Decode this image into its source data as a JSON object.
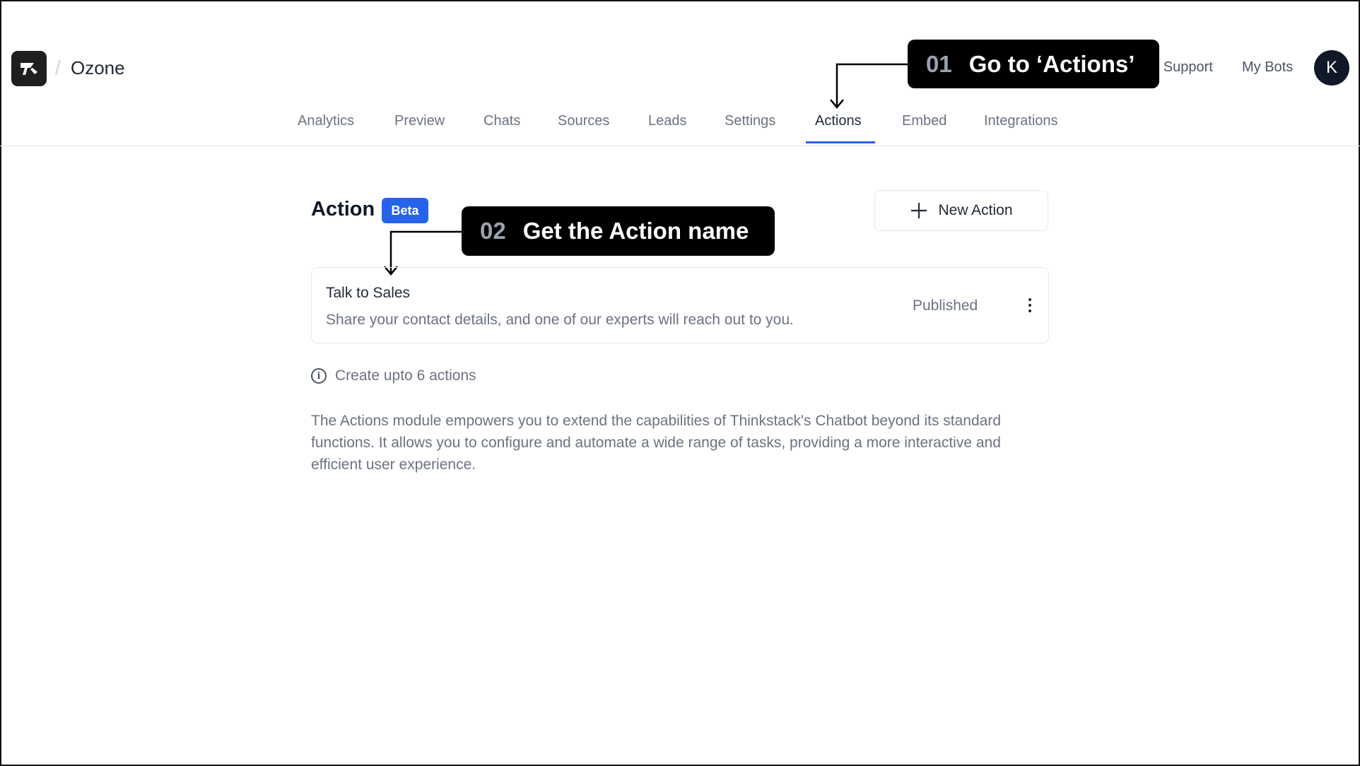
{
  "header": {
    "bot_name": "Ozone",
    "links": [
      "Get Support",
      "My Bots"
    ],
    "avatar_initial": "K"
  },
  "tabs": [
    "Analytics",
    "Preview",
    "Chats",
    "Sources",
    "Leads",
    "Settings",
    "Actions",
    "Embed",
    "Integrations"
  ],
  "active_tab": "Actions",
  "callouts": [
    {
      "number": "01",
      "text": "Go to ‘Actions’"
    },
    {
      "number": "02",
      "text": "Get the Action name"
    }
  ],
  "main": {
    "title": "Action",
    "badge": "Beta",
    "new_action_label": "New Action",
    "actions": [
      {
        "name": "Talk to Sales",
        "description": "Share your contact details, and one of our experts will reach out to you.",
        "status": "Published"
      }
    ],
    "limit_text": "Create upto 6 actions",
    "description": "The Actions module empowers you to extend the capabilities of Thinkstack's Chatbot beyond its standard functions. It allows you to configure and automate a wide range of tasks, providing a more interactive and efficient user experience."
  },
  "colors": {
    "accent": "#2563eb",
    "callout_bg": "#000000",
    "callout_number": "#9ca3af"
  },
  "icons": [
    "logo-icon",
    "plus-icon",
    "kebab-menu-icon",
    "info-icon"
  ]
}
